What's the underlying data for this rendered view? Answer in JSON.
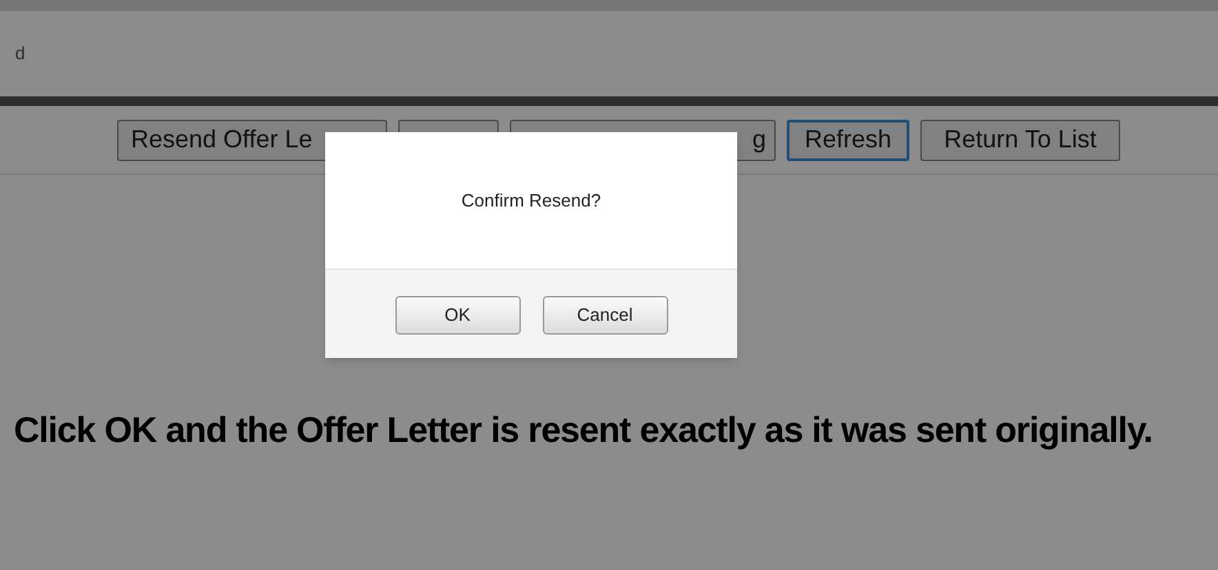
{
  "header": {
    "text": "d"
  },
  "toolbar": {
    "buttons": [
      {
        "label": "Resend Offer Le",
        "focused": false
      },
      {
        "focused": false
      },
      {
        "label": "g",
        "focused": false
      },
      {
        "label": "Refresh",
        "focused": true
      },
      {
        "label": "Return To List",
        "focused": false
      }
    ]
  },
  "dialog": {
    "message": "Confirm Resend?",
    "buttons": [
      "OK",
      "Cancel"
    ]
  },
  "caption": "Click OK and the Offer Letter is resent exactly as it was sent originally."
}
